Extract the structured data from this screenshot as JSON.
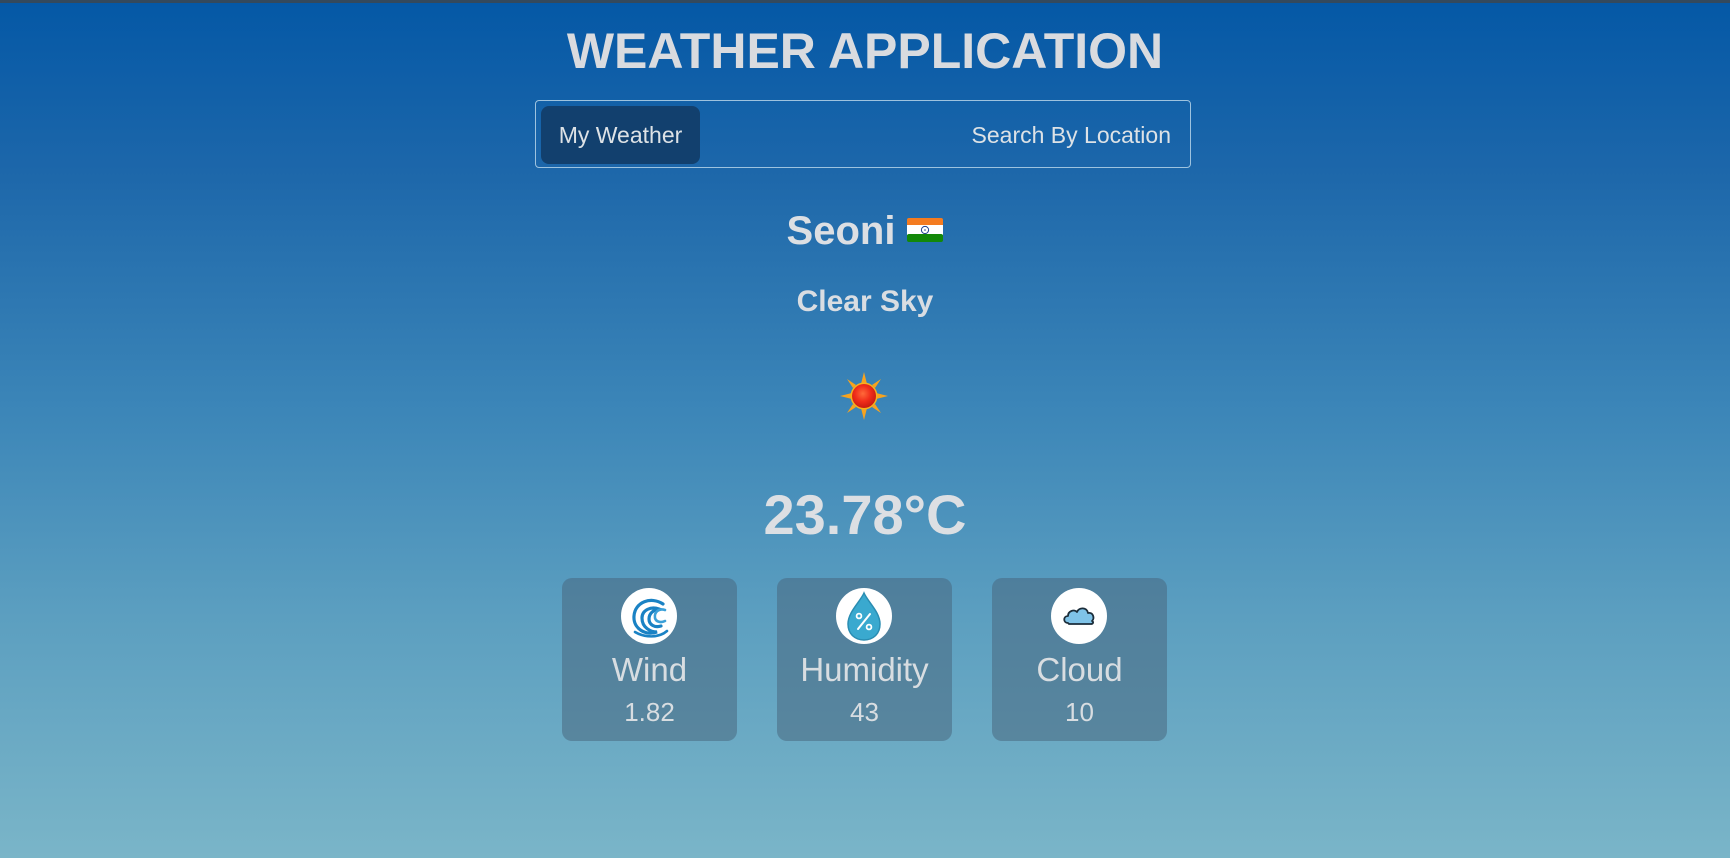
{
  "app": {
    "title": "WEATHER APPLICATION"
  },
  "tabs": [
    {
      "label": "My Weather",
      "active": true
    },
    {
      "label": "Search By Location",
      "active": false
    }
  ],
  "weather": {
    "city": "Seoni",
    "country_flag_icon": "india-flag-icon",
    "description": "Clear Sky",
    "condition_icon": "sun-icon",
    "temperature": "23.78°C"
  },
  "stats": [
    {
      "label": "Wind",
      "value": "1.82",
      "icon": "wind-icon"
    },
    {
      "label": "Humidity",
      "value": "43",
      "icon": "humidity-icon"
    },
    {
      "label": "Cloud",
      "value": "10",
      "icon": "cloud-icon"
    }
  ],
  "colors": {
    "gradient_top": "#0458a6",
    "gradient_bottom": "#7ab5c8",
    "active_tab": "#12406e",
    "text": "#d4d8dc"
  }
}
